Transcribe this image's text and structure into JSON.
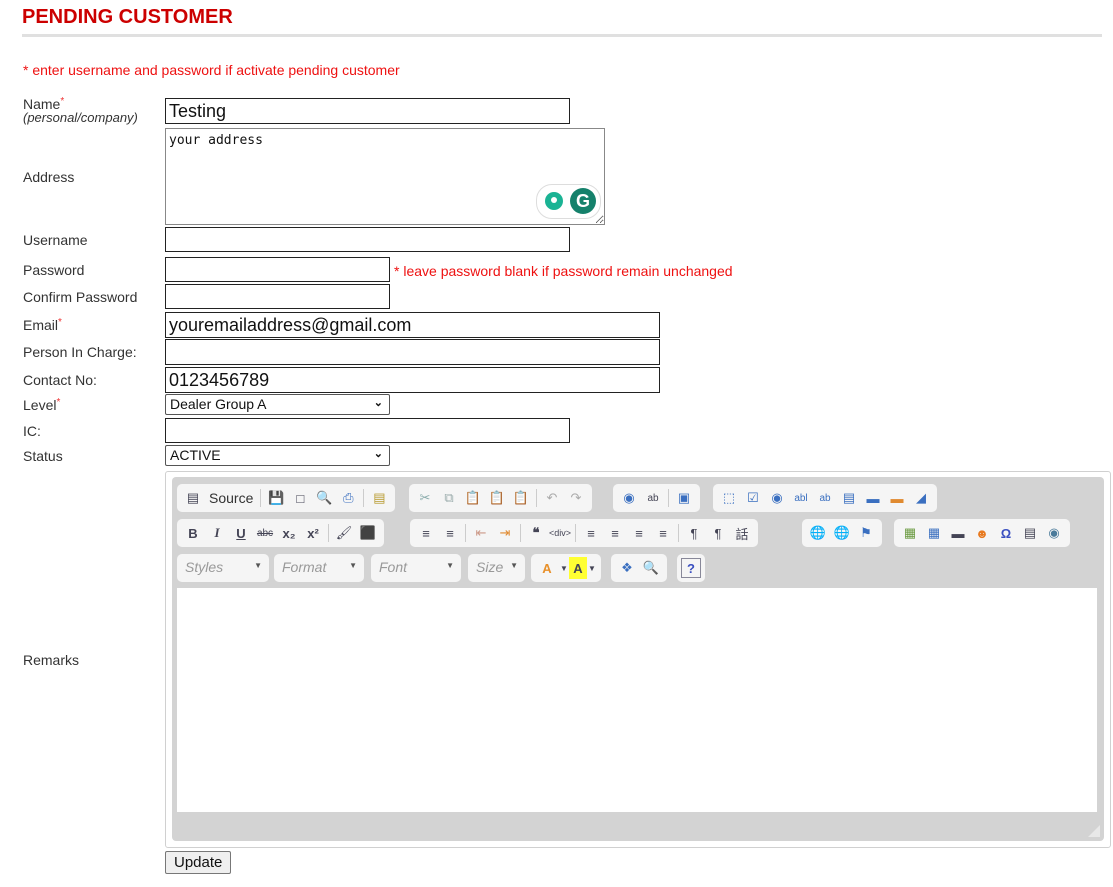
{
  "page": {
    "title": "PENDING CUSTOMER",
    "note": "* enter username and password if activate pending customer"
  },
  "form": {
    "name": {
      "label": "Name",
      "required": "*",
      "sub": "(personal/company)",
      "value": "Testing"
    },
    "address": {
      "label": "Address",
      "value": "your address"
    },
    "username": {
      "label": "Username",
      "value": ""
    },
    "password": {
      "label": "Password",
      "value": "",
      "note": "* leave password blank if password remain unchanged"
    },
    "confirm_password": {
      "label": "Confirm Password",
      "value": ""
    },
    "email": {
      "label": "Email",
      "required": "*",
      "value": "youremailaddress@gmail.com"
    },
    "person_in_charge": {
      "label": "Person In Charge:",
      "value": ""
    },
    "contact_no": {
      "label": "Contact No:",
      "value": "0123456789"
    },
    "level": {
      "label": "Level",
      "required": "*",
      "selected": "Dealer Group A"
    },
    "ic": {
      "label": "IC:",
      "value": ""
    },
    "status": {
      "label": "Status",
      "selected": "ACTIVE"
    },
    "remarks": {
      "label": "Remarks"
    }
  },
  "editor": {
    "source_label": "Source",
    "combos": {
      "styles": "Styles",
      "format": "Format",
      "font": "Font",
      "size": "Size"
    },
    "grammarly_letter": "G"
  },
  "actions": {
    "update_label": "Update"
  }
}
